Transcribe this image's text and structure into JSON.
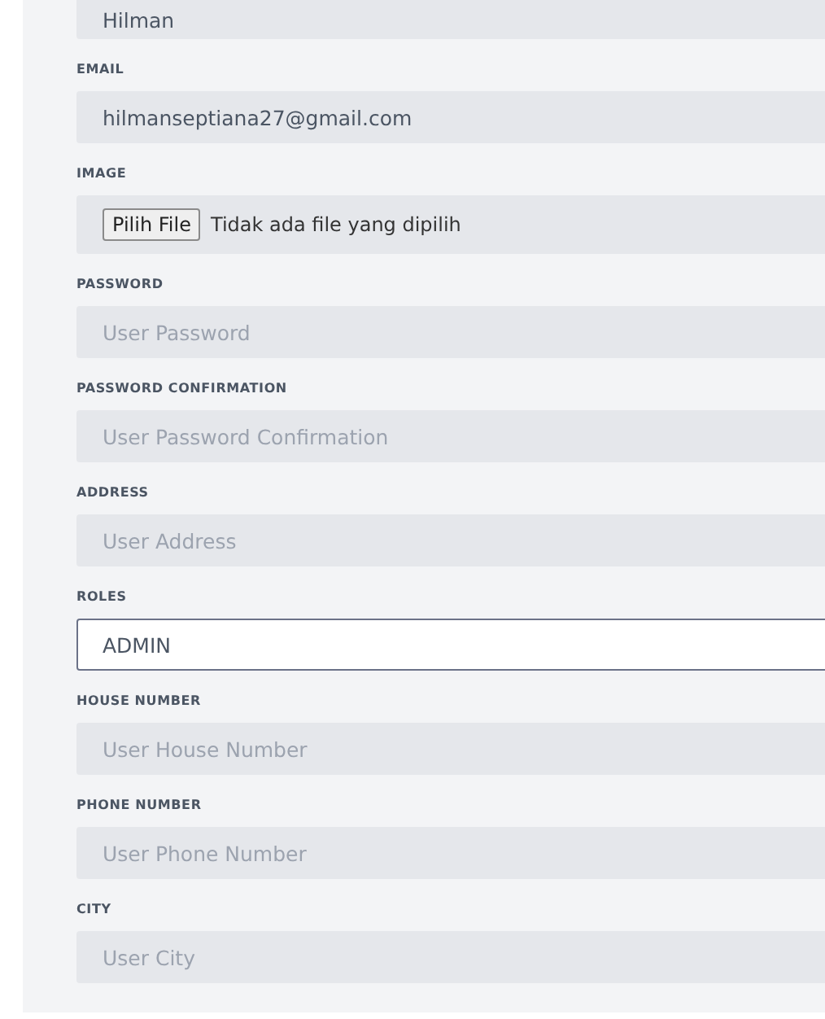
{
  "fields": [
    {
      "kind": "text",
      "value": "Hilman",
      "focused": false
    },
    {
      "kind": "text",
      "label": "EMAIL",
      "value": "hilmanseptiana27@gmail.com",
      "focused": false
    },
    {
      "kind": "file",
      "label": "IMAGE",
      "button": "Pilih File",
      "status": "Tidak ada file yang dipilih"
    },
    {
      "kind": "text",
      "label": "PASSWORD",
      "placeholder": "User Password",
      "focused": false
    },
    {
      "kind": "text",
      "label": "PASSWORD CONFIRMATION",
      "placeholder": "User Password Confirmation",
      "focused": false
    },
    {
      "kind": "text",
      "label": "ADDRESS",
      "placeholder": "User Address",
      "focused": false
    },
    {
      "kind": "text",
      "label": "ROLES",
      "value": "ADMIN",
      "focused": true
    },
    {
      "kind": "text",
      "label": "HOUSE NUMBER",
      "placeholder": "User House Number",
      "focused": false
    },
    {
      "kind": "text",
      "label": "PHONE NUMBER",
      "placeholder": "User Phone Number",
      "focused": false
    },
    {
      "kind": "text",
      "label": "CITY",
      "placeholder": "User City",
      "focused": false
    }
  ]
}
